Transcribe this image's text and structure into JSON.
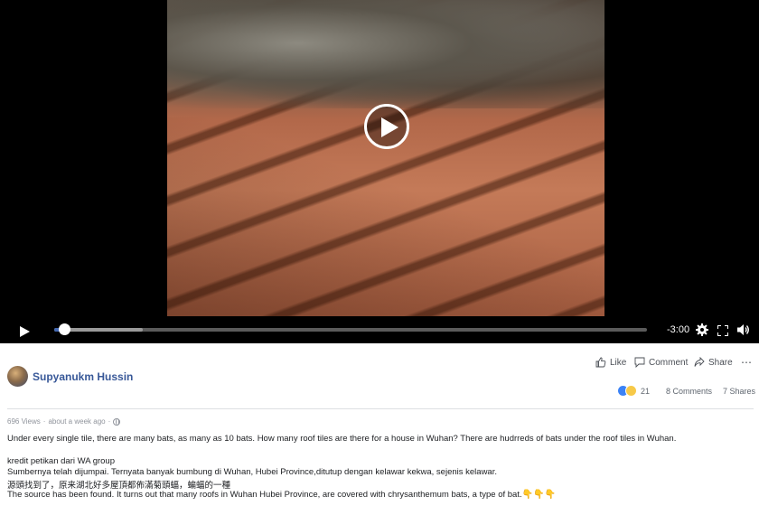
{
  "video": {
    "time_remaining": "-3:00",
    "progress": 0.012,
    "buffered": 0.15
  },
  "post": {
    "author": "Supyanukm Hussin",
    "actions": {
      "like": "Like",
      "comment": "Comment",
      "share": "Share"
    },
    "reaction_count": "21",
    "comments_count": "8 Comments",
    "shares_count": "7 Shares",
    "views": "696 Views",
    "separator": "·",
    "posted_time": "about a week ago",
    "lines": [
      "Under every single tile, there are many bats, as many as 10 bats. How many roof tiles are there for a house in Wuhan? There are hudrreds of bats under the roof tiles in Wuhan.",
      "kredit petikan dari WA group",
      "Sumbernya telah dijumpai. Ternyata banyak bumbung di Wuhan, Hubei Province,ditutup dengan kelawar kekwa, sejenis kelawar.",
      "源頭找到了，原来湖北好多屋頂都佈滿菊頭蝠，蝙蝠的一種",
      "The source has been found. It turns out that many roofs in Wuhan Hubei Province, are covered with chrysanthemum bats, a type of bat."
    ],
    "trailing_emojis": "👇👇👇"
  },
  "colors": {
    "link": "#385898",
    "progress": "#4267b2",
    "muted": "#606770"
  }
}
